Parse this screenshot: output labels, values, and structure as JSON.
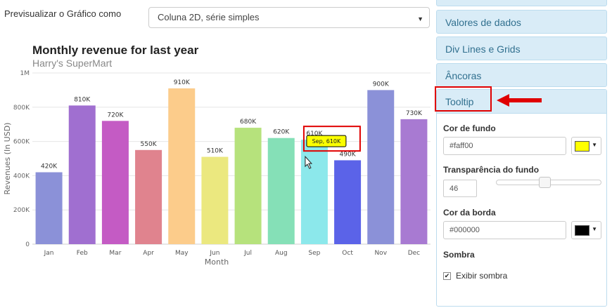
{
  "preview": {
    "label": "Previsualizar o Gráfico como",
    "select_value": "Coluna 2D, série simples"
  },
  "panel": {
    "sections": [
      "Valores de dados",
      "Div Lines e Grids",
      "Âncoras",
      "Tooltip"
    ],
    "tooltip": {
      "bg_label": "Cor de fundo",
      "bg_value": "#faff00",
      "bg_swatch": "#ffff00",
      "transparency_label": "Transparência do fundo",
      "transparency_value": "46",
      "transparency_level": 46,
      "border_label": "Cor da borda",
      "border_value": "#000000",
      "border_swatch": "#000000",
      "shadow_heading": "Sombra",
      "shadow_checkbox_label": "Exibir sombra",
      "shadow_checked": true
    }
  },
  "chart_data": {
    "type": "bar",
    "title": "Monthly revenue for last year",
    "subtitle": "Harry's SuperMart",
    "xlabel": "Month",
    "ylabel": "Revenues (In USD)",
    "ylim": [
      0,
      1000000
    ],
    "yticks": [
      "0",
      "200K",
      "400K",
      "600K",
      "800K",
      "1M"
    ],
    "categories": [
      "Jan",
      "Feb",
      "Mar",
      "Apr",
      "May",
      "Jun",
      "Jul",
      "Aug",
      "Sep",
      "Oct",
      "Nov",
      "Dec"
    ],
    "values": [
      420000,
      810000,
      720000,
      550000,
      910000,
      510000,
      680000,
      620000,
      610000,
      490000,
      900000,
      730000
    ],
    "value_labels": [
      "420K",
      "810K",
      "720K",
      "550K",
      "910K",
      "510K",
      "680K",
      "620K",
      "610K",
      "490K",
      "900K",
      "730K"
    ],
    "colors": [
      "#8b91d8",
      "#a06fd0",
      "#c45bc4",
      "#e0838e",
      "#fccc8b",
      "#ebe87f",
      "#b6e27c",
      "#85e0b7",
      "#8ce8eb",
      "#5b63e8",
      "#8b91d8",
      "#a87ad2"
    ],
    "grid": true,
    "tooltip": {
      "text": "Sep, 610K",
      "bg": "#faff00",
      "border": "#000000"
    }
  }
}
